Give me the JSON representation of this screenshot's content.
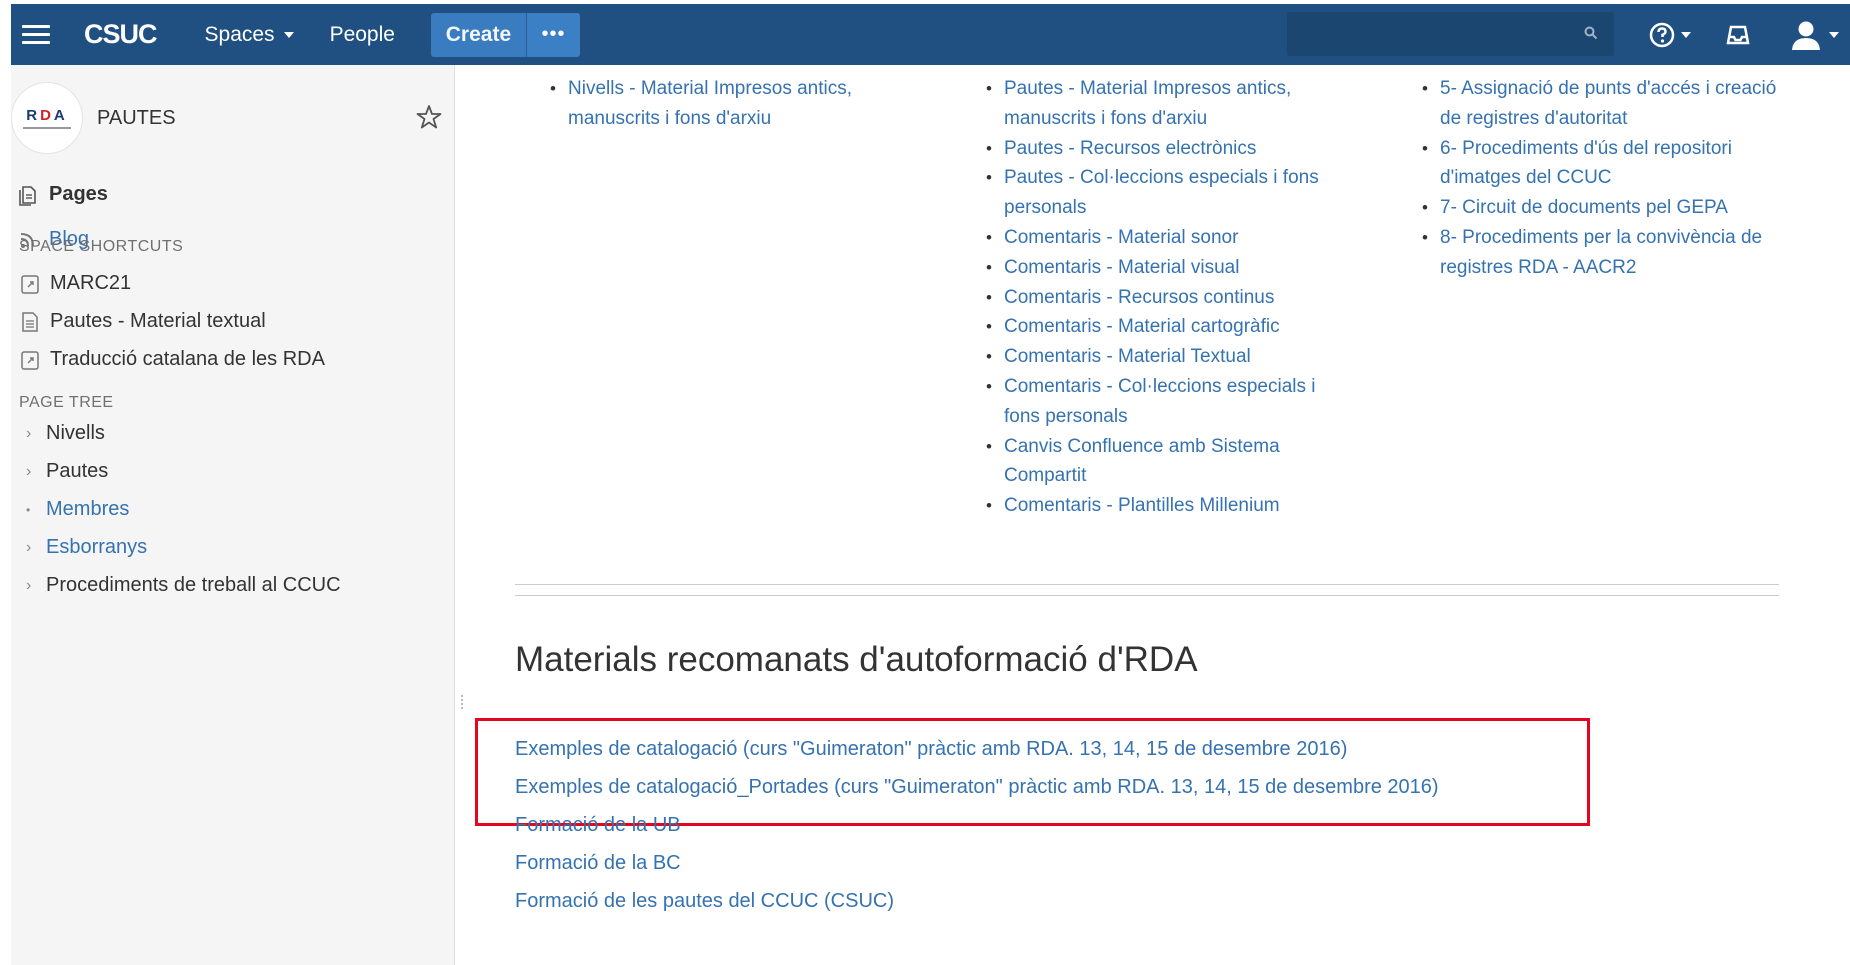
{
  "header": {
    "logo": "CSUC",
    "spaces": "Spaces",
    "people": "People",
    "create": "Create",
    "more": "•••",
    "search_value": "",
    "accent": "#205081"
  },
  "sidebar": {
    "space_logo_text": "RDA",
    "space_name": "PAUTES",
    "pages": "Pages",
    "blog": "Blog",
    "shortcuts_title": "SPACE SHORTCUTS",
    "shortcuts": [
      "MARC21",
      "Pautes - Material textual",
      "Traducció catalana de les RDA"
    ],
    "tree_title": "PAGE TREE",
    "tree": [
      "Nivells",
      "Pautes",
      "Membres",
      "Esborranys",
      "Procediments de treball al CCUC"
    ]
  },
  "content": {
    "col1": [
      "Nivells - Material Impresos antics, manuscrits i fons d'arxiu"
    ],
    "col2": [
      "Pautes - Material Impresos antics, manuscrits i fons d'arxiu",
      "Pautes - Recursos electrònics",
      "Pautes - Col·leccions especials i fons personals",
      "Comentaris - Material sonor",
      "Comentaris - Material visual",
      "Comentaris - Recursos continus",
      "Comentaris - Material cartogràfic",
      "Comentaris - Material Textual",
      "Comentaris - Col·leccions especials i fons personals",
      "Canvis Confluence amb Sistema Compartit",
      "Comentaris - Plantilles Millenium"
    ],
    "col3": [
      "5- Assignació de punts d'accés i creació de registres d'autoritat",
      "6- Procediments d'ús del repositori d'imatges del CCUC",
      "7- Circuit de documents pel GEPA",
      "8- Procediments per la convivència de registres RDA - AACR2"
    ],
    "heading": "Materials recomanats d'autoformació d'RDA",
    "links": [
      "Exemples de catalogació (curs \"Guimeraton\" pràctic amb RDA. 13, 14, 15 de desembre 2016)",
      "Exemples de catalogació_Portades (curs \"Guimeraton\" pràctic amb RDA. 13, 14, 15 de desembre 2016)",
      "Formació de la UB",
      "Formació de la BC",
      "Formació de les pautes del CCUC (CSUC)"
    ]
  }
}
